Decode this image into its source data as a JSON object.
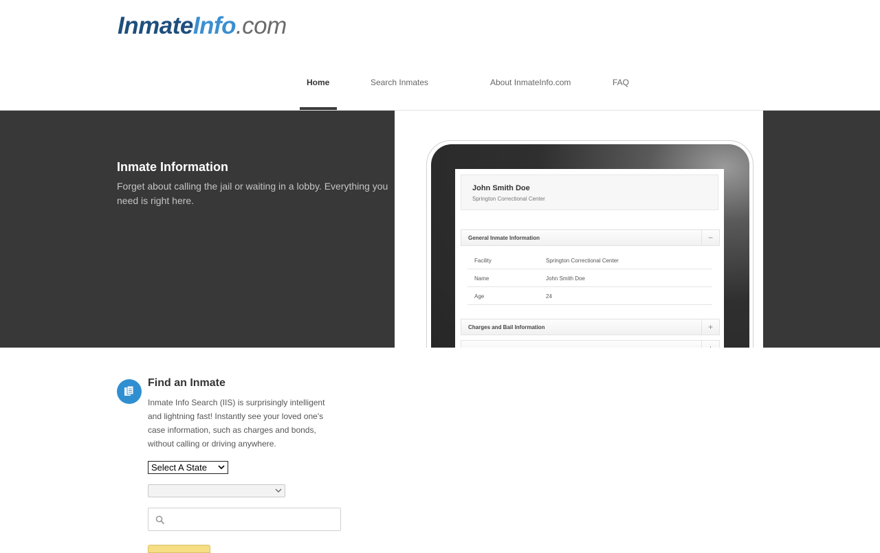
{
  "logo": {
    "part1": "Inmate",
    "part2": "Info",
    "part3": ".com"
  },
  "nav": {
    "items": [
      {
        "label": "Home",
        "active": true
      },
      {
        "label": "Search Inmates",
        "active": false
      },
      {
        "label": "About InmateInfo.com",
        "active": false
      },
      {
        "label": "FAQ",
        "active": false
      }
    ]
  },
  "hero": {
    "title": "Inmate Information",
    "text": "Forget about calling the jail or waiting in a lobby. Everything you need is right here."
  },
  "preview": {
    "name": "John Smith Doe",
    "facility_sub": "Springton Correctional Center",
    "general_header": "General Inmate Information",
    "general_toggle": "−",
    "rows": [
      {
        "key": "Facility",
        "value": "Springton Correctional Center"
      },
      {
        "key": "Name",
        "value": "John Smith Doe"
      },
      {
        "key": "Age",
        "value": "24"
      }
    ],
    "charges_header": "Charges and Bail Information",
    "charges_toggle": "+",
    "court_toggle": "+"
  },
  "find": {
    "title": "Find an Inmate",
    "text": "Inmate Info Search (IIS) is surprisingly intelligent and lightning fast! Instantly see your loved one's case information, such as charges and bonds, without calling or driving anywhere.",
    "state_select": "Select A State",
    "county_select": "",
    "search_placeholder": ""
  },
  "colors": {
    "hero_bg": "#383838",
    "brand_dark": "#1e4f7d",
    "brand_light": "#3b8fd0",
    "icon_circle": "#2f8fd1",
    "button": "#f6de84"
  }
}
